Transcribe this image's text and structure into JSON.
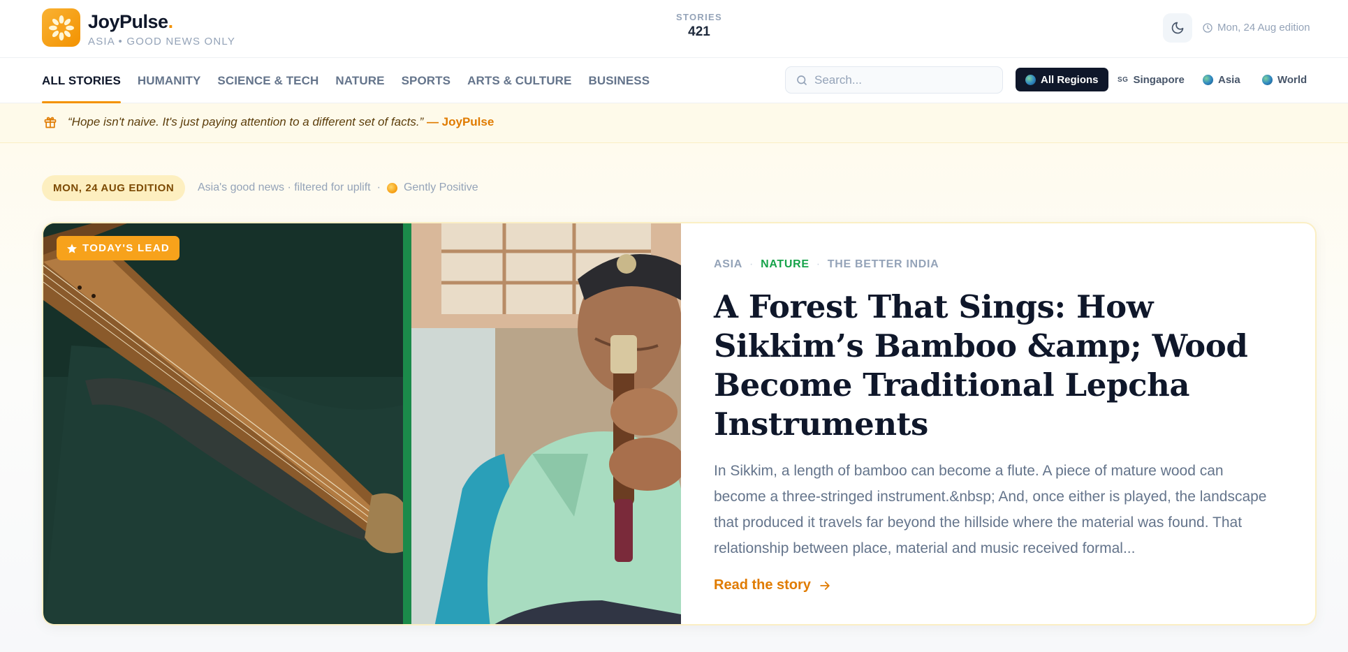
{
  "header": {
    "brand_name": "JoyPulse",
    "brand_dot": ".",
    "brand_tagline": "ASIA • GOOD NEWS ONLY",
    "stories_label": "STORIES",
    "stories_count": "421",
    "edition_label": "Mon, 24 Aug edition"
  },
  "nav": {
    "tabs": [
      {
        "label": "ALL STORIES",
        "active": true
      },
      {
        "label": "HUMANITY"
      },
      {
        "label": "SCIENCE & TECH"
      },
      {
        "label": "NATURE"
      },
      {
        "label": "SPORTS"
      },
      {
        "label": "ARTS & CULTURE"
      },
      {
        "label": "BUSINESS"
      }
    ],
    "search_placeholder": "Search...",
    "regions": [
      {
        "label": "All Regions",
        "icon": "globe-icon",
        "active": true
      },
      {
        "label": "Singapore",
        "code": "SG"
      },
      {
        "label": "Asia",
        "icon": "globe-icon"
      },
      {
        "label": "World",
        "icon": "globe-icon"
      }
    ]
  },
  "quote": {
    "text": "“Hope isn't naive. It's just paying attention to a different set of facts.”",
    "author": "— JoyPulse"
  },
  "edition": {
    "pill": "MON, 24 AUG EDITION",
    "meta": "Asia's good news · filtered for uplift",
    "sep": "·",
    "mood": "Gently Positive"
  },
  "lead": {
    "badge": "TODAY'S LEAD",
    "tags": [
      "ASIA",
      "NATURE",
      "THE BETTER INDIA"
    ],
    "headline": "A Forest That Sings: How Sikkim’s Bamboo &amp; Wood Become Traditional Lepcha Instruments",
    "summary": "In Sikkim, a length of bamboo can become a flute. A piece of mature wood can become a three-stringed instrument.&nbsp; And, once either is played, the landscape that produced it travels far beyond the hillside where the material was found. That relationship between place, material and music received formal...",
    "read_more": "Read the story"
  },
  "colors": {
    "accent": "#f39200",
    "nature_tag": "#16a34a",
    "ink": "#0f172a",
    "muted": "#94a3b8"
  }
}
